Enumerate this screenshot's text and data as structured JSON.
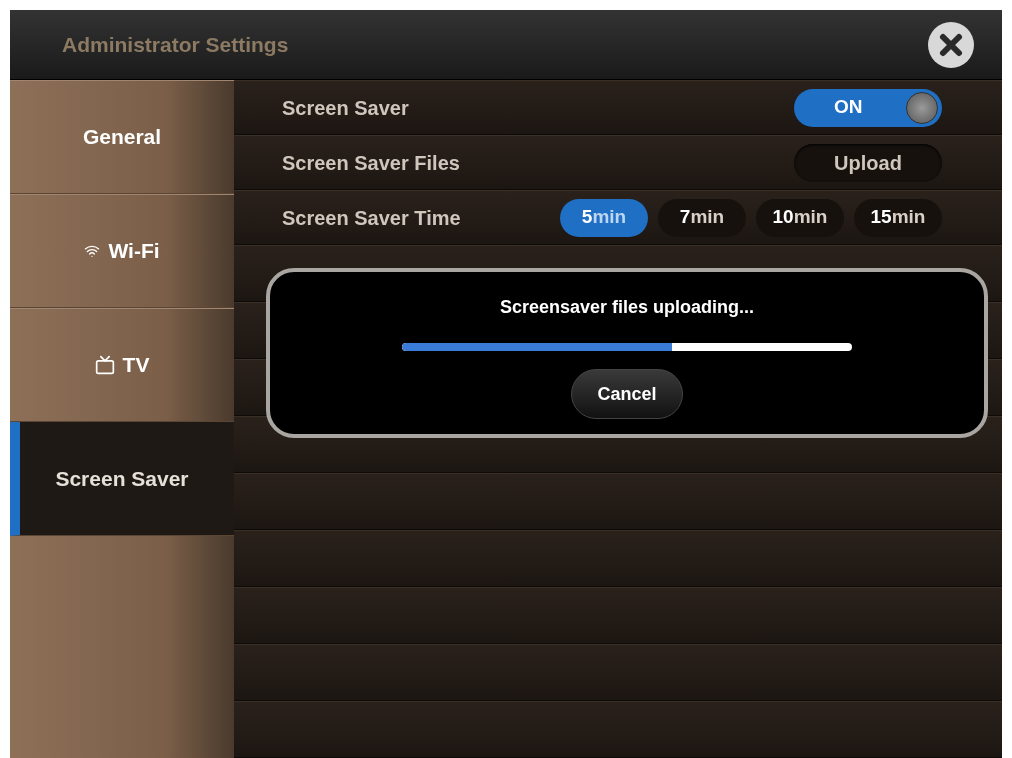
{
  "window": {
    "title": "Administrator Settings"
  },
  "sidebar": {
    "items": [
      {
        "label": "General",
        "selected": false
      },
      {
        "label": "Wi-Fi",
        "selected": false
      },
      {
        "label": "TV",
        "selected": false
      },
      {
        "label": "Screen Saver",
        "selected": true
      }
    ]
  },
  "settings": [
    {
      "kind": "toggle",
      "label": "Screen Saver",
      "on": true,
      "value": "ON"
    },
    {
      "kind": "button",
      "label": "Screen Saver Files",
      "button": "Upload"
    },
    {
      "kind": "options",
      "label": "Screen Saver Time",
      "options": [
        {
          "number": "5",
          "unit": "min",
          "selected": true
        },
        {
          "number": "7",
          "unit": "min",
          "selected": false
        },
        {
          "number": "10",
          "unit": "min",
          "selected": false
        },
        {
          "number": "15",
          "unit": "min",
          "selected": false
        }
      ]
    }
  ],
  "dialog": {
    "message": "Screensaver files uploading...",
    "progress": {
      "level": 0.6
    },
    "button": "Cancel"
  }
}
